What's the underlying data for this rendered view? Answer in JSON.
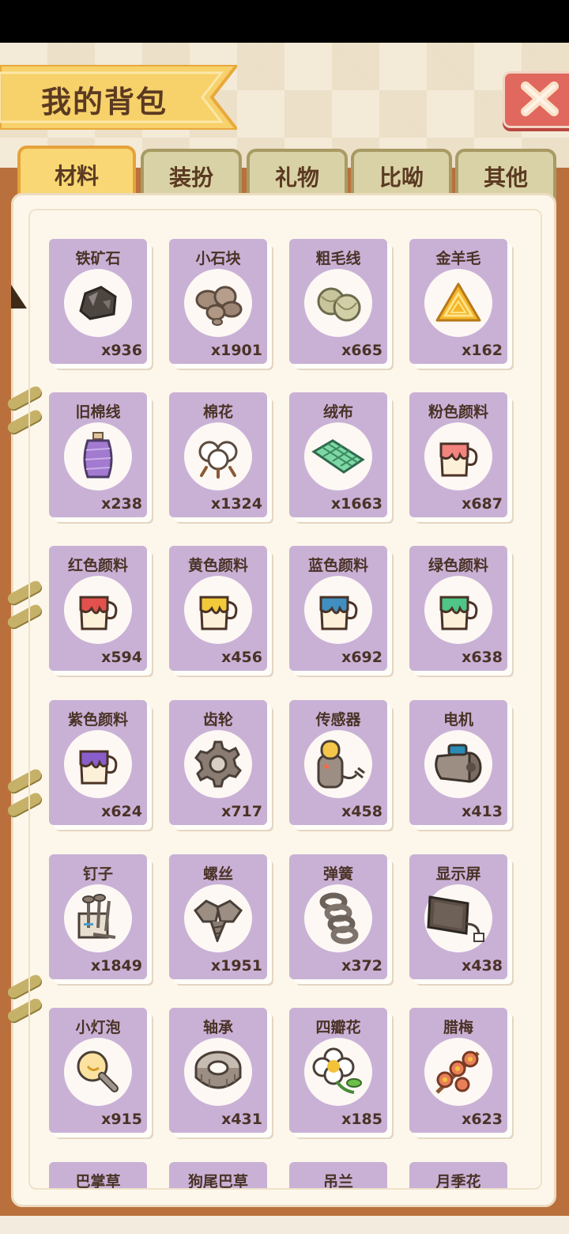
{
  "title": "我的背包",
  "tabs": [
    "材料",
    "装扮",
    "礼物",
    "比呦",
    "其他"
  ],
  "active_tab": 0,
  "items": [
    {
      "name": "铁矿石",
      "count": "x936",
      "icon": "iron-ore-icon"
    },
    {
      "name": "小石块",
      "count": "x1901",
      "icon": "stones-icon"
    },
    {
      "name": "粗毛线",
      "count": "x665",
      "icon": "yarn-icon"
    },
    {
      "name": "金羊毛",
      "count": "x162",
      "icon": "golden-fleece-icon"
    },
    {
      "name": "旧棉线",
      "count": "x238",
      "icon": "thread-spool-icon"
    },
    {
      "name": "棉花",
      "count": "x1324",
      "icon": "cotton-icon"
    },
    {
      "name": "绒布",
      "count": "x1663",
      "icon": "velvet-cloth-icon"
    },
    {
      "name": "粉色颜料",
      "count": "x687",
      "icon": "paint-bucket-icon",
      "color": "#f2837f"
    },
    {
      "name": "红色颜料",
      "count": "x594",
      "icon": "paint-bucket-icon",
      "color": "#e2514d"
    },
    {
      "name": "黄色颜料",
      "count": "x456",
      "icon": "paint-bucket-icon",
      "color": "#f2c93a"
    },
    {
      "name": "蓝色颜料",
      "count": "x692",
      "icon": "paint-bucket-icon",
      "color": "#3f8fc0"
    },
    {
      "name": "绿色颜料",
      "count": "x638",
      "icon": "paint-bucket-icon",
      "color": "#4fc587"
    },
    {
      "name": "紫色颜料",
      "count": "x624",
      "icon": "paint-bucket-icon",
      "color": "#8a5ec9"
    },
    {
      "name": "齿轮",
      "count": "x717",
      "icon": "gear-icon"
    },
    {
      "name": "传感器",
      "count": "x458",
      "icon": "sensor-icon"
    },
    {
      "name": "电机",
      "count": "x413",
      "icon": "motor-icon"
    },
    {
      "name": "钉子",
      "count": "x1849",
      "icon": "nails-icon"
    },
    {
      "name": "螺丝",
      "count": "x1951",
      "icon": "screws-icon"
    },
    {
      "name": "弹簧",
      "count": "x372",
      "icon": "spring-icon"
    },
    {
      "name": "显示屏",
      "count": "x438",
      "icon": "display-screen-icon"
    },
    {
      "name": "小灯泡",
      "count": "x915",
      "icon": "light-bulb-icon"
    },
    {
      "name": "轴承",
      "count": "x431",
      "icon": "bearing-icon"
    },
    {
      "name": "四瓣花",
      "count": "x185",
      "icon": "four-petal-flower-icon"
    },
    {
      "name": "腊梅",
      "count": "x623",
      "icon": "wintersweet-icon"
    },
    {
      "name": "巴掌草",
      "icon": "plant-icon"
    },
    {
      "name": "狗尾巴草",
      "icon": "plant-icon"
    },
    {
      "name": "吊兰",
      "icon": "plant-icon"
    },
    {
      "name": "月季花",
      "icon": "plant-icon"
    }
  ]
}
